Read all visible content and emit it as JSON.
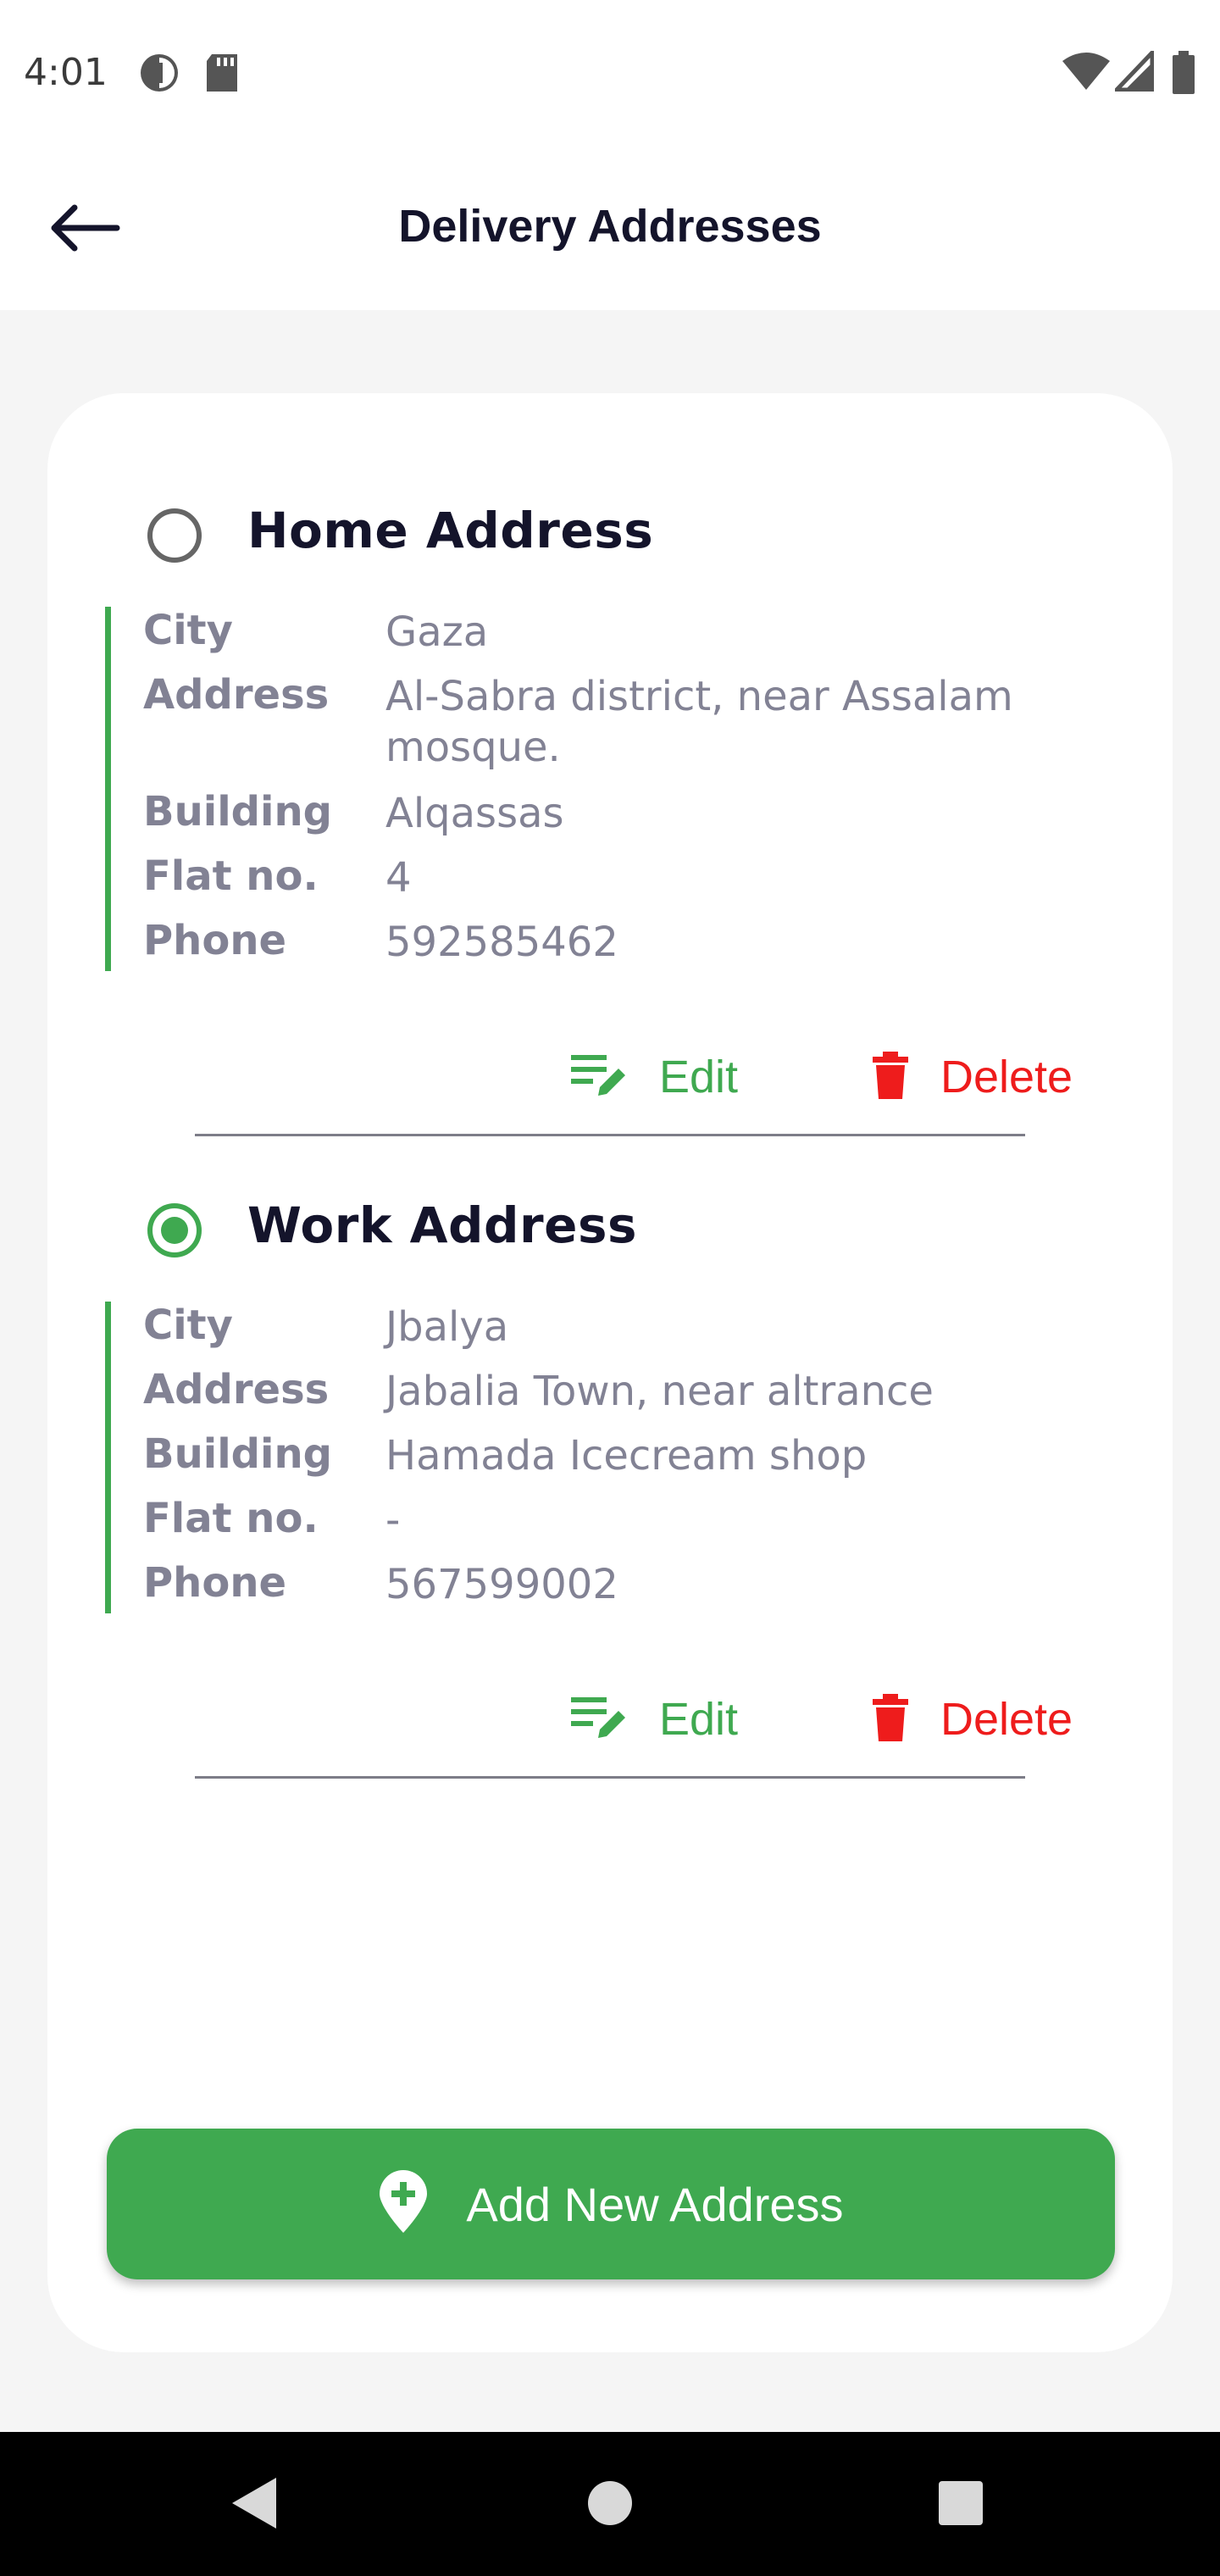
{
  "status_bar": {
    "time": "4:01",
    "left_icons": [
      "data-saver-icon",
      "sd-card-icon"
    ],
    "right_icons": [
      "wifi-icon",
      "signal-icon",
      "battery-icon"
    ]
  },
  "app_bar": {
    "title": "Delivery Addresses",
    "back_icon": "arrow-left-icon"
  },
  "addresses": [
    {
      "title": "Home Address",
      "selected": false,
      "fields": [
        {
          "label": "City",
          "value": "Gaza"
        },
        {
          "label": "Address",
          "value": "Al-Sabra district, near Assalam mosque."
        },
        {
          "label": "Building",
          "value": "Alqassas"
        },
        {
          "label": "Flat no.",
          "value": "4"
        },
        {
          "label": "Phone",
          "value": "592585462"
        }
      ],
      "edit_label": "Edit",
      "delete_label": "Delete"
    },
    {
      "title": "Work Address",
      "selected": true,
      "fields": [
        {
          "label": "City",
          "value": "Jbalya"
        },
        {
          "label": "Address",
          "value": "Jabalia Town, near altrance"
        },
        {
          "label": "Building",
          "value": "Hamada Icecream shop"
        },
        {
          "label": "Flat no.",
          "value": "-"
        },
        {
          "label": "Phone",
          "value": "567599002"
        }
      ],
      "edit_label": "Edit",
      "delete_label": "Delete"
    }
  ],
  "add_button": {
    "label": "Add New Address",
    "icon": "location-plus-icon"
  },
  "colors": {
    "accent_green": "#3fa950",
    "delete_red": "#ee1c1c",
    "title_dark": "#14142b",
    "field_gray": "#828294"
  },
  "nav_bar": {
    "icons": [
      "back-triangle-icon",
      "home-circle-icon",
      "recents-square-icon"
    ]
  }
}
